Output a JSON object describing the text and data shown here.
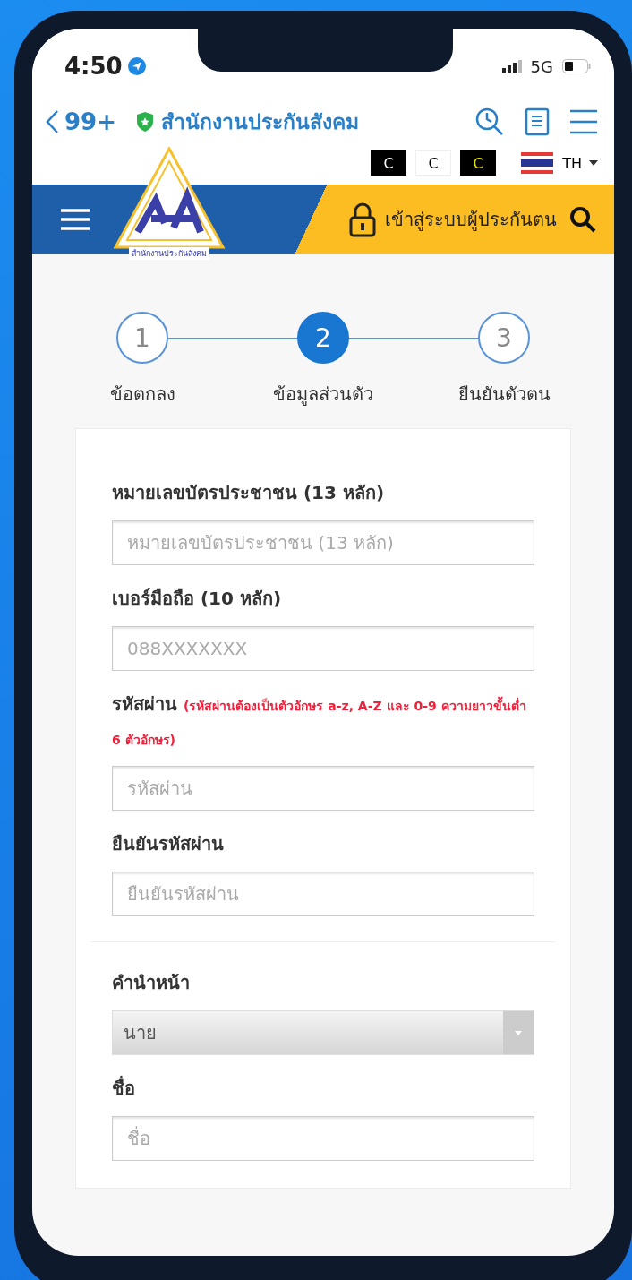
{
  "status_bar": {
    "time": "4:50",
    "network": "5G"
  },
  "browser_bar": {
    "back": "99+",
    "site_title": "สำนักงานประกันสังคม"
  },
  "contrast_buttons": [
    {
      "label": "C",
      "kind": "dark"
    },
    {
      "label": "C",
      "kind": "light"
    },
    {
      "label": "C",
      "kind": "yellow"
    }
  ],
  "language": "TH",
  "header": {
    "logo_caption": "สำนักงานประกันสังคม",
    "login": "เข้าสู่ระบบผู้ประกันตน"
  },
  "steps": [
    {
      "number": "1",
      "label": "ข้อตกลง",
      "selected": false
    },
    {
      "number": "2",
      "label": "ข้อมูลส่วนตัว",
      "selected": true
    },
    {
      "number": "3",
      "label": "ยืนยันตัวตน",
      "selected": false
    }
  ],
  "form_sections": [
    {
      "fields": [
        {
          "kind": "text",
          "label": "หมายเลขบัตรประชาชน (13 หลัก)",
          "placeholder": "หมายเลขบัตรประชาชน (13 หลัก)"
        },
        {
          "kind": "text",
          "label": "เบอร์มือถือ (10 หลัก)",
          "placeholder": "088XXXXXXX"
        },
        {
          "kind": "text",
          "label": "รหัสผ่าน",
          "note": "(รหัสผ่านต้องเป็นตัวอักษร a-z, A-Z และ 0-9 ความยาวขั้นต่ำ 6 ตัวอักษร)",
          "placeholder": "รหัสผ่าน"
        },
        {
          "kind": "text",
          "label": "ยืนยันรหัสผ่าน",
          "placeholder": "ยืนยันรหัสผ่าน"
        }
      ]
    },
    {
      "fields": [
        {
          "kind": "select",
          "label": "คำนำหน้า",
          "value": "นาย"
        },
        {
          "kind": "text",
          "label": "ชื่อ",
          "placeholder": "ชื่อ"
        }
      ]
    }
  ]
}
